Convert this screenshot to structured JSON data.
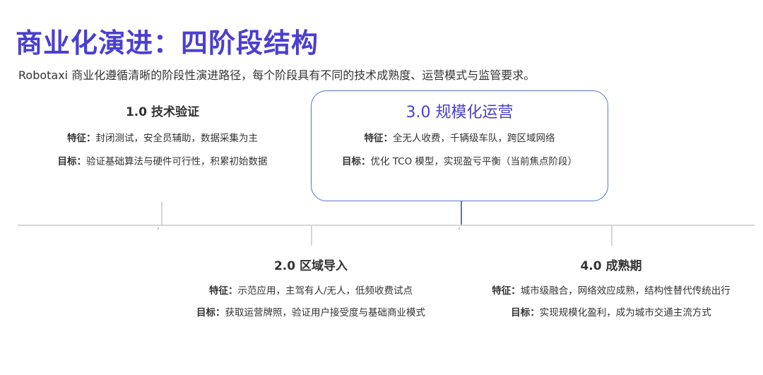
{
  "header": {
    "title": "商业化演进：四阶段结构",
    "subtitle": "Robotaxi 商业化遵循清晰的阶段性演进路径，每个阶段具有不同的技术成熟度、运营模式与监管要求。"
  },
  "labels": {
    "feature": "特征：",
    "goal": "目标："
  },
  "stages": [
    {
      "title": "1.0 技术验证",
      "feature": "封闭测试，安全员辅助，数据采集为主",
      "goal": "验证基础算法与硬件可行性，积累初始数据"
    },
    {
      "title": "2.0 区域导入",
      "feature": "示范应用，主驾有人/无人，低频收费试点",
      "goal": "获取运营牌照，验证用户接受度与基础商业模式"
    },
    {
      "title": "3.0 规模化运营",
      "feature": "全无人收费，千辆级车队，跨区域网络",
      "goal": "优化 TCO 模型，实现盈亏平衡（当前焦点阶段）"
    },
    {
      "title": "4.0 成熟期",
      "feature": "城市级融合，网络效应成熟，结构性替代传统出行",
      "goal": "实现规模化盈利，成为城市交通主流方式"
    }
  ]
}
